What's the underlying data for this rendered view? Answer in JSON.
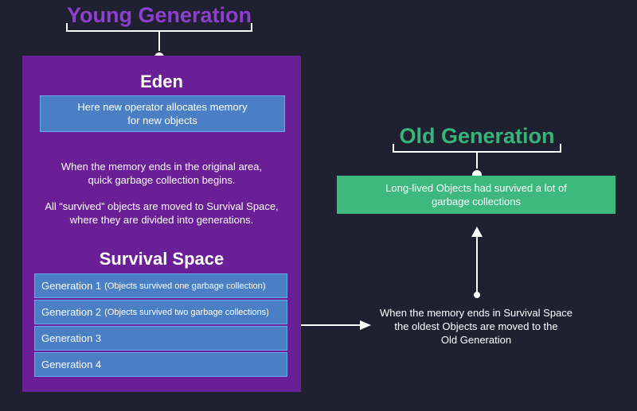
{
  "young_generation": {
    "title": "Young Generation",
    "eden": {
      "title": "Eden",
      "box_line1": "Here new operator allocates memory",
      "box_line2": "for new objects",
      "note1_line1": "When the memory ends in the original area,",
      "note1_line2": "quick garbage collection begins.",
      "note2_line1": "All “survived” objects are moved to Survival Space,",
      "note2_line2": "where they are divided into generations."
    },
    "survival_space": {
      "title": "Survival Space",
      "generations": [
        {
          "label": "Generation 1",
          "detail": "(Objects survived one garbage collection)"
        },
        {
          "label": "Generation 2",
          "detail": "(Objects survived two garbage collections)"
        },
        {
          "label": "Generation 3",
          "detail": ""
        },
        {
          "label": "Generation 4",
          "detail": ""
        }
      ]
    }
  },
  "old_generation": {
    "title": "Old Generation",
    "box_line1": "Long-lived Objects had survived a lot of",
    "box_line2": "garbage collections"
  },
  "transfer_note": {
    "line1": "When the memory ends in Survival Space",
    "line2": "the oldest Objects are moved to the",
    "line3": "Old Generation"
  },
  "colors": {
    "background": "#1f2131",
    "young_accent": "#8e3fd0",
    "young_panel": "#6a1f97",
    "blue_box": "#4a7fc6",
    "old_accent": "#38b47a",
    "old_box": "#3db97d"
  }
}
